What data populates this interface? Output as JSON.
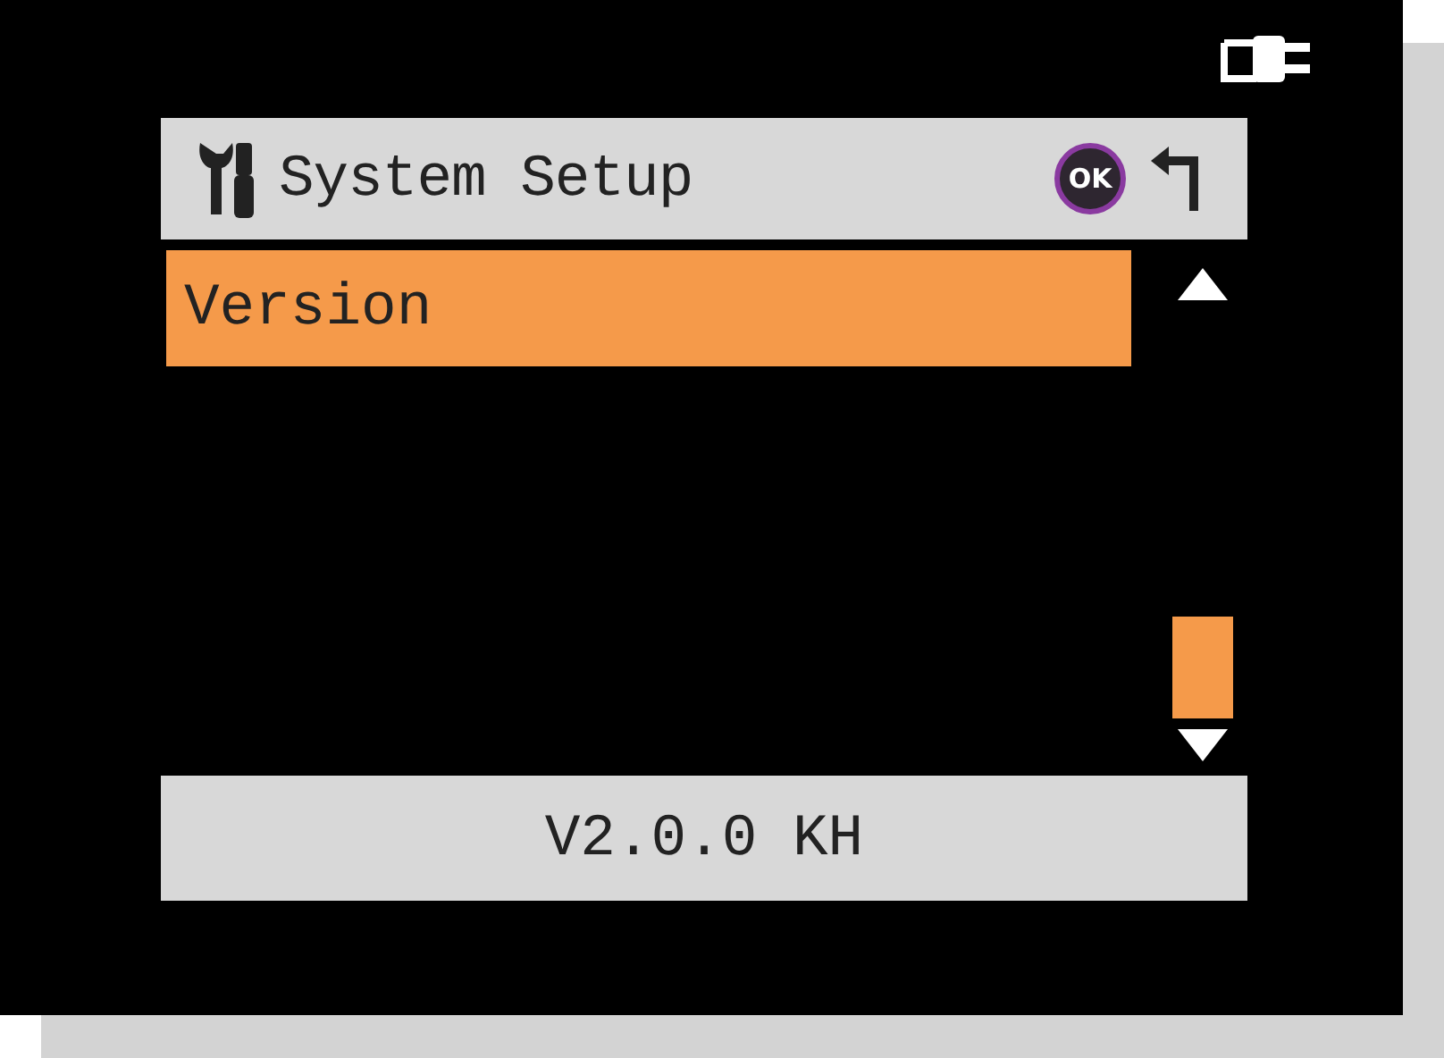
{
  "header": {
    "title": "System Setup",
    "ok_label": "OK"
  },
  "menu": {
    "items": [
      {
        "label": "Version",
        "selected": true
      }
    ]
  },
  "value_bar": {
    "text": "V2.0.0 KH"
  }
}
